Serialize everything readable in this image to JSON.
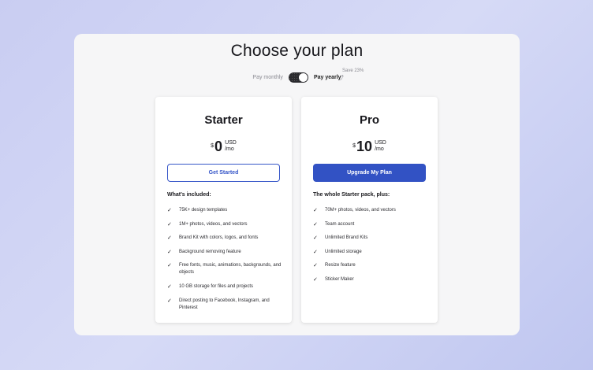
{
  "header": {
    "title": "Choose your plan"
  },
  "billing": {
    "monthly_label": "Pay monthly",
    "yearly_label": "Pay yearly",
    "save_label": "Save 23%",
    "yearly_selected": true
  },
  "plans": [
    {
      "name": "Starter",
      "currency": "$",
      "amount": "0",
      "unit_top": "USD",
      "unit_bottom": "/mo",
      "button_label": "Get Started",
      "included_label": "What's included:",
      "features": [
        "75K+ design templates",
        "1M+ photos, videos, and vectors",
        "Brand Kit with colors, logos, and fonts",
        "Background removing feature",
        "Free fonts, music, animations, backgrounds, and objects",
        "10 GB storage for files and projects",
        "Direct posting to Facebook, Instagram, and Pinterest"
      ]
    },
    {
      "name": "Pro",
      "currency": "$",
      "amount": "10",
      "unit_top": "USD",
      "unit_bottom": "/mo",
      "button_label": "Upgrade My Plan",
      "included_label": "The whole Starter pack, plus:",
      "features": [
        "70M+ photos, videos, and vectors",
        "Team account",
        "Unlimited Brand Kits",
        "Unlimited storage",
        "Resize feature",
        "Sticker Maker"
      ]
    }
  ],
  "colors": {
    "accent": "#3252c4",
    "panel": "#f6f6f7"
  },
  "icons": {
    "check": "check-icon",
    "arrow": "curved-arrow-icon"
  }
}
